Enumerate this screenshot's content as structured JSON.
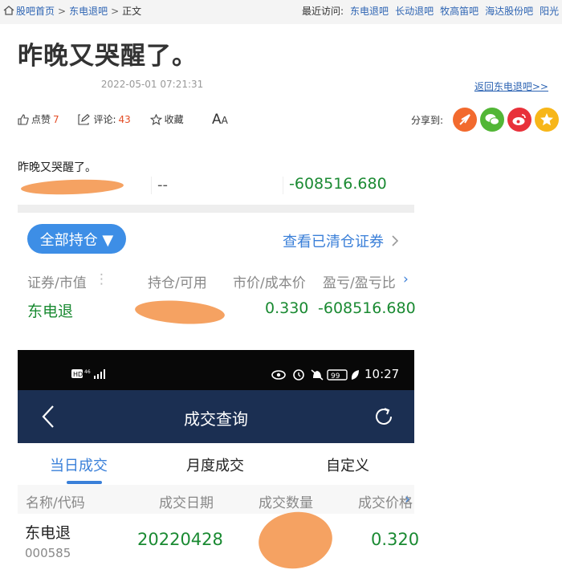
{
  "breadcrumb": {
    "home": "股吧首页",
    "bar": "东电退吧",
    "current": "正文"
  },
  "recent": {
    "label": "最近访问:",
    "items": [
      "东电退吧",
      "长动退吧",
      "牧高笛吧",
      "海达股份吧",
      "阳光"
    ]
  },
  "post": {
    "title": "昨晚又哭醒了。",
    "timestamp": "2022-05-01 07:21:31",
    "back_link": "返回东电退吧>>",
    "body": "昨晚又哭醒了。"
  },
  "actions": {
    "like_label": "点赞",
    "like_count": "7",
    "comment_label": "评论:",
    "comment_count": "43",
    "fav_label": "收藏",
    "font_size_label": "A",
    "font_size_small": "A"
  },
  "share": {
    "label": "分享到:",
    "targets": [
      "feed-icon",
      "wechat-icon",
      "weibo-icon",
      "qzone-icon"
    ]
  },
  "holdings_shot": {
    "summary_dash": "--",
    "summary_value": "-608516.680",
    "hold_button": "全部持仓 ▼",
    "view_cleared": "查看已清仓证券",
    "headers": [
      "证券/市值",
      "持仓/可用",
      "市价/成本价",
      "盈亏/盈亏比"
    ],
    "row": {
      "name": "东电退",
      "price": "0.330",
      "pnl": "-608516.680"
    }
  },
  "trade_shot": {
    "status_time": "10:27",
    "battery": "99",
    "title": "成交查询",
    "tabs": [
      "当日成交",
      "月度成交",
      "自定义"
    ],
    "headers": [
      "名称/代码",
      "成交日期",
      "成交数量",
      "成交价格"
    ],
    "row": {
      "name": "东电退",
      "code": "000585",
      "date": "20220428",
      "price": "0.320"
    }
  },
  "colors": {
    "link": "#2d64b3",
    "gain_green": "#1a8a32",
    "accent_blue": "#3a80d9",
    "nav_dark": "#1b2f52"
  }
}
